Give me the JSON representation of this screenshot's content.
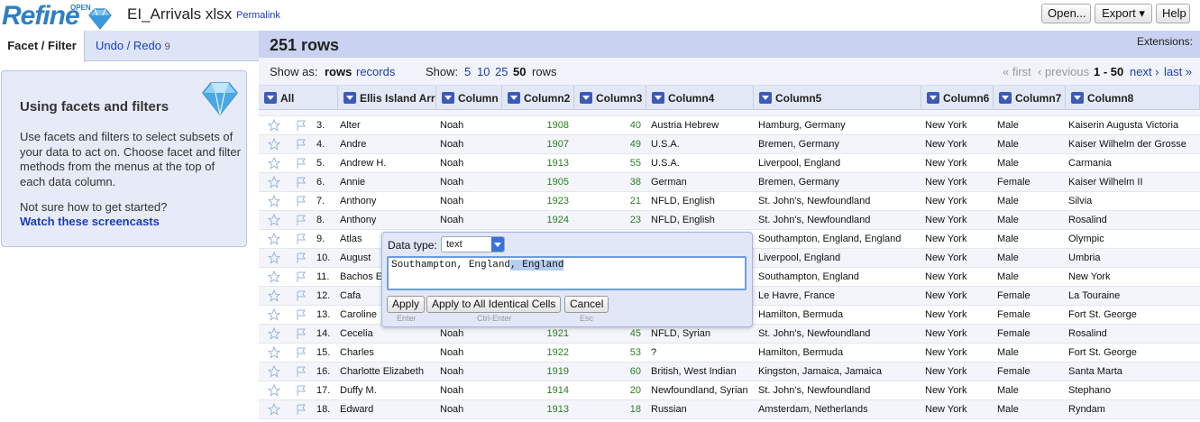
{
  "app": {
    "logo_text": "Refine",
    "logo_sup": "OPEN",
    "project_title": "EI_Arrivals xlsx",
    "permalink": "Permalink"
  },
  "toolbar": {
    "open": "Open...",
    "export": "Export ▾",
    "help": "Help"
  },
  "left_tabs": {
    "facet": "Facet / Filter",
    "undo": "Undo / Redo",
    "undo_count": "9"
  },
  "help_box": {
    "title": "Using facets and filters",
    "body": "Use facets and filters to select subsets of your data to act on. Choose facet and filter methods from the menus at the top of each data column.",
    "question": "Not sure how to get started?",
    "link": "Watch these screencasts"
  },
  "grid_header": {
    "rows_count": "251 rows",
    "extensions": "Extensions:"
  },
  "view_bar": {
    "show_as": "Show as:",
    "rows": "rows",
    "records": "records",
    "show": "Show:",
    "sizes": [
      "5",
      "10",
      "25",
      "50"
    ],
    "rows_word": "rows",
    "first": "« first",
    "previous": "‹ previous",
    "range": "1 - 50",
    "next": "next ›",
    "last": "last »"
  },
  "columns": [
    "All",
    "Ellis Island Arriv",
    "Column",
    "Column2",
    "Column3",
    "Column4",
    "Column5",
    "Column6",
    "Column7",
    "Column8"
  ],
  "rows": [
    {
      "n": "3.",
      "c1": "Alter",
      "c": "Noah",
      "c2": "1908",
      "c3": "40",
      "c4": "Austria Hebrew",
      "c5": "Hamburg, Germany",
      "c6": "New York",
      "c7": "Male",
      "c8": "Kaiserin Augusta Victoria"
    },
    {
      "n": "4.",
      "c1": "Andre",
      "c": "Noah",
      "c2": "1907",
      "c3": "49",
      "c4": "U.S.A.",
      "c5": "Bremen, Germany",
      "c6": "New York",
      "c7": "Male",
      "c8": "Kaiser Wilhelm der Grosse"
    },
    {
      "n": "5.",
      "c1": "Andrew H.",
      "c": "Noah",
      "c2": "1913",
      "c3": "55",
      "c4": "U.S.A.",
      "c5": "Liverpool, England",
      "c6": "New York",
      "c7": "Male",
      "c8": "Carmania"
    },
    {
      "n": "6.",
      "c1": "Annie",
      "c": "Noah",
      "c2": "1905",
      "c3": "38",
      "c4": "German",
      "c5": "Bremen, Germany",
      "c6": "New York",
      "c7": "Female",
      "c8": "Kaiser Wilhelm II"
    },
    {
      "n": "7.",
      "c1": "Anthony",
      "c": "Noah",
      "c2": "1923",
      "c3": "21",
      "c4": "NFLD, English",
      "c5": "St. John's, Newfoundland",
      "c6": "New York",
      "c7": "Male",
      "c8": "Silvia"
    },
    {
      "n": "8.",
      "c1": "Anthony",
      "c": "Noah",
      "c2": "1924",
      "c3": "23",
      "c4": "NFLD, English",
      "c5": "St. John's, Newfoundland",
      "c6": "New York",
      "c7": "Male",
      "c8": "Rosalind"
    },
    {
      "n": "9.",
      "c1": "Atlas",
      "c": "",
      "c2": "",
      "c3": "",
      "c4": "",
      "c5": "Southampton, England, England",
      "c6": "New York",
      "c7": "Male",
      "c8": "Olympic"
    },
    {
      "n": "10.",
      "c1": "August",
      "c": "",
      "c2": "",
      "c3": "",
      "c4": "",
      "c5": "Liverpool, England",
      "c6": "New York",
      "c7": "Male",
      "c8": "Umbria"
    },
    {
      "n": "11.",
      "c1": "Bachos E",
      "c": "",
      "c2": "",
      "c3": "",
      "c4": "",
      "c5": "Southampton, England",
      "c6": "New York",
      "c7": "Male",
      "c8": "New York"
    },
    {
      "n": "12.",
      "c1": "Cafa",
      "c": "",
      "c2": "",
      "c3": "",
      "c4": "",
      "c5": "Le Havre, France",
      "c6": "New York",
      "c7": "Female",
      "c8": "La Touraine"
    },
    {
      "n": "13.",
      "c1": "Caroline",
      "c": "",
      "c2": "",
      "c3": "",
      "c4": "",
      "c5": "Hamilton, Bermuda",
      "c6": "New York",
      "c7": "Female",
      "c8": "Fort St. George"
    },
    {
      "n": "14.",
      "c1": "Cecelia",
      "c": "Noah",
      "c2": "1921",
      "c3": "45",
      "c4": "NFLD, Syrian",
      "c5": "St. John's, Newfoundland",
      "c6": "New York",
      "c7": "Female",
      "c8": "Rosalind"
    },
    {
      "n": "15.",
      "c1": "Charles",
      "c": "Noah",
      "c2": "1922",
      "c3": "53",
      "c4": "?",
      "c5": "Hamilton, Bermuda",
      "c6": "New York",
      "c7": "Male",
      "c8": "Fort St. George"
    },
    {
      "n": "16.",
      "c1": "Charlotte Elizabeth",
      "c": "Noah",
      "c2": "1919",
      "c3": "60",
      "c4": "British, West Indian",
      "c5": "Kingston, Jamaica, Jamaica",
      "c6": "New York",
      "c7": "Female",
      "c8": "Santa Marta"
    },
    {
      "n": "17.",
      "c1": "Duffy M.",
      "c": "Noah",
      "c2": "1914",
      "c3": "20",
      "c4": "Newfoundland, Syrian",
      "c5": "St. John's, Newfoundland",
      "c6": "New York",
      "c7": "Male",
      "c8": "Stephano"
    },
    {
      "n": "18.",
      "c1": "Edward",
      "c": "Noah",
      "c2": "1913",
      "c3": "18",
      "c4": "Russian",
      "c5": "Amsterdam, Netherlands",
      "c6": "New York",
      "c7": "Male",
      "c8": "Ryndam"
    }
  ],
  "popup": {
    "data_type_label": "Data type:",
    "data_type_value": "text",
    "text_plain": "Southampton, England",
    "text_selected": ", England",
    "apply": "Apply",
    "apply_all": "Apply to All Identical Cells",
    "cancel": "Cancel",
    "hint_enter": "Enter",
    "hint_ctrl": "Ctrl-Enter",
    "hint_esc": "Esc"
  }
}
